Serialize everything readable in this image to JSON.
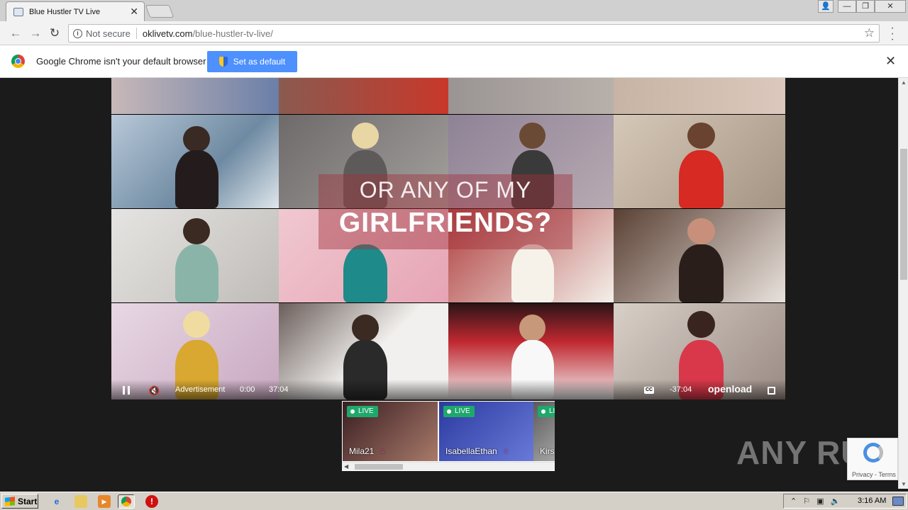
{
  "browser": {
    "tab_title": "Blue Hustler TV Live",
    "close_label": "✕",
    "window_controls": [
      "👤",
      "—",
      "❐",
      "✕"
    ]
  },
  "toolbar": {
    "not_secure": "Not secure",
    "url_host": "oklivetv.com",
    "url_path": "/blue-hustler-tv-live/"
  },
  "infobar": {
    "message": "Google Chrome isn't your default browser",
    "button": "Set as default",
    "close": "✕"
  },
  "video": {
    "overlay_line1": "OR ANY OF MY",
    "overlay_line2": "GIRLFRIENDS?",
    "ad_label": "Advertisement",
    "time_elapsed": "0:00",
    "time_total": "37:04",
    "time_remaining": "-37:04",
    "cc_label": "CC",
    "brand": "openload",
    "progress": 0
  },
  "live_cards": [
    {
      "badge": "LIVE",
      "name": "Mila21",
      "color": "#7a4a56"
    },
    {
      "badge": "LIVE",
      "name": "IsabellaEthan",
      "color": "#3b4da8"
    },
    {
      "badge": "LI",
      "name": "Kirs",
      "color": "#8a8a8a"
    }
  ],
  "watermark": "ANY RUN",
  "recaptcha": {
    "text": "Privacy - Terms"
  },
  "taskbar": {
    "start": "Start",
    "clock": "3:16 AM"
  }
}
